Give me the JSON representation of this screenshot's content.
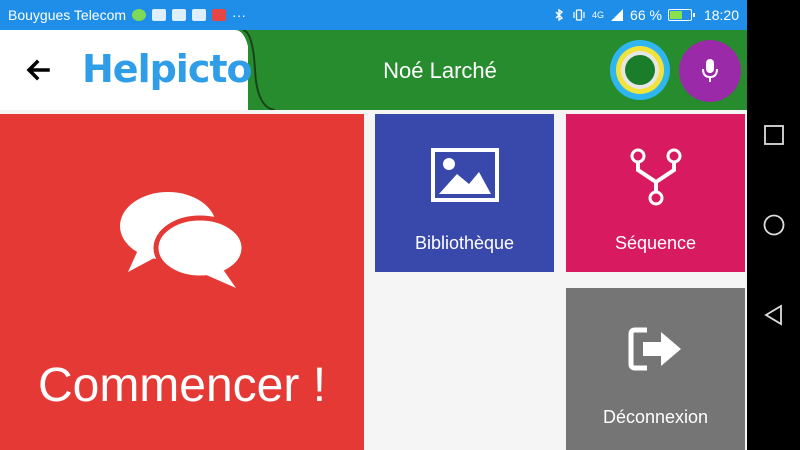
{
  "status_bar": {
    "carrier": "Bouygues Telecom",
    "more": "···",
    "network": "4G",
    "battery": "66 %",
    "battery_level": 0.66,
    "time": "18:20"
  },
  "header": {
    "logo_part1": "Helpicto",
    "user_name": "Noé Larché"
  },
  "tiles": {
    "start_label": "Commencer !",
    "library_label": "Bibliothèque",
    "sequence_label": "Séquence",
    "logout_label": "Déconnexion"
  },
  "icons": {
    "back": "arrow-left-icon",
    "mic": "microphone-icon",
    "start": "speech-bubbles-icon",
    "library": "image-icon",
    "sequence": "fork-icon",
    "logout": "exit-icon"
  },
  "colors": {
    "status_bar": "#1f8ee8",
    "header_green": "#268c2d",
    "start": "#e53935",
    "library": "#3949ab",
    "sequence": "#d81b60",
    "logout": "#757575",
    "mic": "#9b2aa8"
  }
}
